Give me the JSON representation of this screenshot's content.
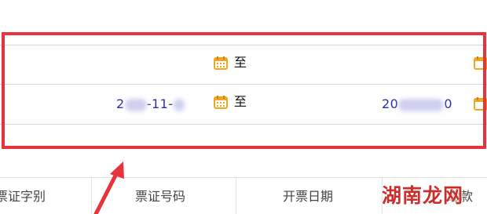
{
  "filter_rows": [
    {
      "date_from": "",
      "to_label": "至",
      "date_to": ""
    },
    {
      "date_from_prefix": "2",
      "date_from_mid": "-11-",
      "to_label": "至",
      "date_to_prefix": "20",
      "date_to_suffix": "0"
    }
  ],
  "icons": {
    "calendar": "calendar-icon"
  },
  "table": {
    "headers": [
      "票证字别",
      "票证号码",
      "开票日期",
      "缴款"
    ]
  },
  "watermark": {
    "text": "湖南龙网"
  },
  "colors": {
    "highlight": "#e8323c",
    "date_text": "#2c2ca8",
    "calendar": "#f0a81e"
  }
}
